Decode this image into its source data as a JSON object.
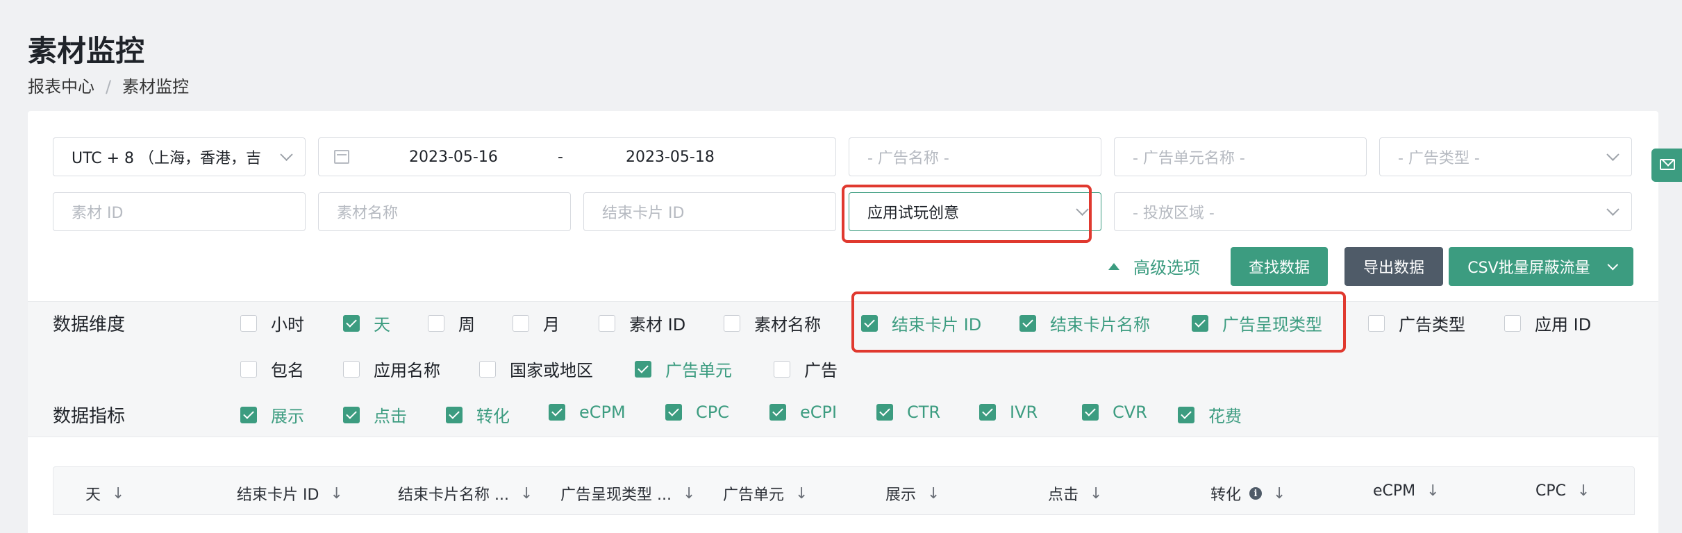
{
  "page": {
    "title": "素材监控",
    "breadcrumb": [
      "报表中心",
      "素材监控"
    ],
    "breadcrumb_sep": "/"
  },
  "filters": {
    "timezone": "UTC + 8 （上海，香港，吉",
    "date_start": "2023-05-16",
    "date_sep": "-",
    "date_end": "2023-05-18",
    "ad_name_placeholder": "- 广告名称 -",
    "ad_unit_name_placeholder": "- 广告单元名称 -",
    "ad_type_placeholder": "- 广告类型 -",
    "material_id_placeholder": "素材 ID",
    "material_name_placeholder": "素材名称",
    "end_card_id_placeholder": "结束卡片 ID",
    "creative_type_value": "应用试玩创意",
    "region_placeholder": "- 投放区域 -"
  },
  "actions": {
    "advanced": "高级选项",
    "search": "查找数据",
    "export": "导出数据",
    "csv": "CSV批量屏蔽流量"
  },
  "dimensions": {
    "label": "数据维度",
    "items": [
      {
        "label": "小时",
        "checked": false
      },
      {
        "label": "天",
        "checked": true
      },
      {
        "label": "周",
        "checked": false
      },
      {
        "label": "月",
        "checked": false
      },
      {
        "label": "素材 ID",
        "checked": false
      },
      {
        "label": "素材名称",
        "checked": false
      },
      {
        "label": "结束卡片 ID",
        "checked": true
      },
      {
        "label": "结束卡片名称",
        "checked": true
      },
      {
        "label": "广告呈现类型",
        "checked": true
      },
      {
        "label": "广告类型",
        "checked": false
      },
      {
        "label": "应用 ID",
        "checked": false
      },
      {
        "label": "包名",
        "checked": false
      },
      {
        "label": "应用名称",
        "checked": false
      },
      {
        "label": "国家或地区",
        "checked": false
      },
      {
        "label": "广告单元",
        "checked": true
      },
      {
        "label": "广告",
        "checked": false
      }
    ]
  },
  "metrics": {
    "label": "数据指标",
    "items": [
      {
        "label": "展示",
        "checked": true
      },
      {
        "label": "点击",
        "checked": true
      },
      {
        "label": "转化",
        "checked": true
      },
      {
        "label": "eCPM",
        "checked": true
      },
      {
        "label": "CPC",
        "checked": true
      },
      {
        "label": "eCPI",
        "checked": true
      },
      {
        "label": "CTR",
        "checked": true
      },
      {
        "label": "IVR",
        "checked": true
      },
      {
        "label": "CVR",
        "checked": true
      },
      {
        "label": "花费",
        "checked": true
      }
    ]
  },
  "table": {
    "columns": [
      "天",
      "结束卡片 ID",
      "结束卡片名称 ...",
      "广告呈现类型 ...",
      "广告单元",
      "展示",
      "点击",
      "转化",
      "eCPM",
      "CPC"
    ],
    "sort_icon": "↓",
    "info_icon": "i"
  },
  "colors": {
    "accent": "#3c9c80",
    "highlight": "#e0392f",
    "dark_button": "#4f5b68"
  }
}
